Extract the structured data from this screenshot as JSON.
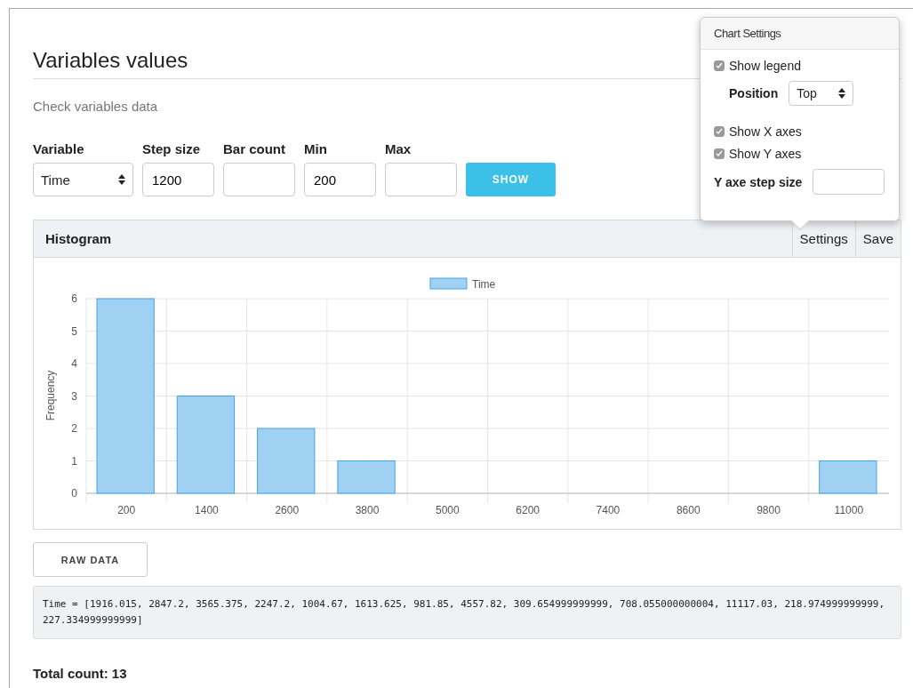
{
  "page": {
    "title": "Variables values",
    "subtitle": "Check variables data"
  },
  "form": {
    "fields": [
      {
        "kind": "select",
        "label": "Variable",
        "value": "Time"
      },
      {
        "kind": "input",
        "label": "Step size",
        "value": "1200"
      },
      {
        "kind": "input",
        "label": "Bar count"
      },
      {
        "kind": "input",
        "label": "Min",
        "value": "200"
      },
      {
        "kind": "input",
        "label": "Max"
      }
    ],
    "button": "SHOW"
  },
  "panel": {
    "title": "Histogram",
    "actions": [
      "Settings",
      "Save"
    ],
    "chart_data": {
      "type": "bar",
      "ylabel": "Frequency",
      "categories": [
        "200",
        "1400",
        "2600",
        "3800",
        "5000",
        "6200",
        "7400",
        "8600",
        "9800",
        "11000"
      ],
      "series": [
        {
          "name": "Time",
          "color": "#a0d0f2",
          "values": [
            6,
            3,
            2,
            1,
            0,
            0,
            0,
            0,
            0,
            1
          ]
        }
      ],
      "ylim": [
        0,
        6
      ],
      "grid": true,
      "yticks": [
        0,
        1,
        2,
        3,
        4,
        5,
        6
      ]
    }
  },
  "settings_popover": {
    "title": "Chart Settings",
    "items": [
      {
        "kind": "checkbox",
        "label": "Show legend",
        "checked": true
      },
      {
        "kind": "select",
        "label": "Position",
        "value": "Top"
      },
      {
        "kind": "checkbox",
        "label": "Show X axes",
        "checked": true
      },
      {
        "kind": "checkbox",
        "label": "Show Y axes",
        "checked": true
      },
      {
        "kind": "input",
        "label": "Y axe step size"
      }
    ]
  },
  "raw_button": "RAW DATA",
  "raw_data": "Time = [1916.015, 2847.2, 3565.375, 2247.2, 1004.67, 1613.625, 981.85, 4557.82, 309.654999999999, 708.055000000004, 11117.03, 218.974999999999, 227.334999999999]",
  "total": "Total count: 13"
}
